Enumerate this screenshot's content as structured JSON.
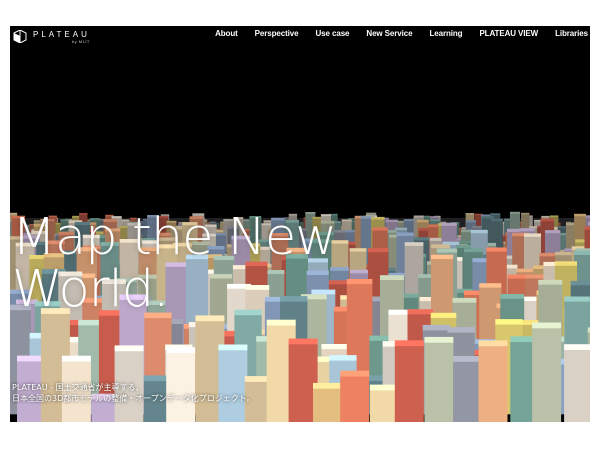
{
  "brand": {
    "name": "PLATEAU",
    "subtitle": "by MLIT"
  },
  "nav": {
    "items": [
      {
        "label": "About"
      },
      {
        "label": "Perspective"
      },
      {
        "label": "Use case"
      },
      {
        "label": "New Service"
      },
      {
        "label": "Learning"
      },
      {
        "label": "PLATEAU VIEW"
      },
      {
        "label": "Libraries"
      }
    ]
  },
  "hero": {
    "title_line1": "Map the New",
    "title_line2": "World.",
    "tagline_line1": "PLATEAU - 国土交通省が主導する、",
    "tagline_line2": "日本全国の3D都市モデルの整備・オープンデータ化プロジェクト。"
  },
  "colors": {
    "background": "#000000",
    "page": "#ffffff",
    "text": "#ffffff"
  }
}
